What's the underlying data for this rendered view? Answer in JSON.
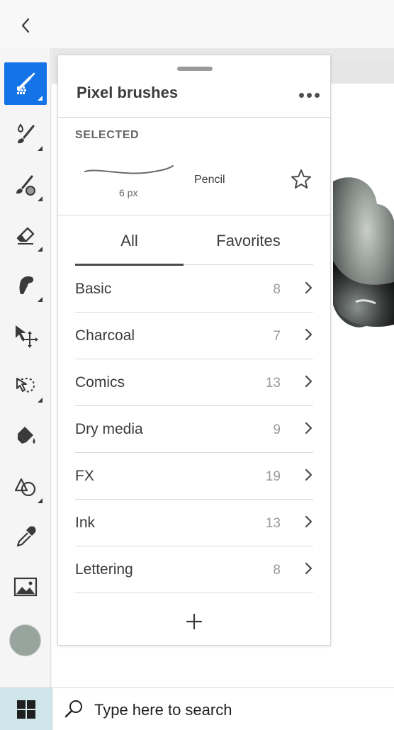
{
  "colors": {
    "accent": "#1473e6",
    "current_color": "#98a59e",
    "taskbar_start": "#cfe6ea"
  },
  "top_bar": {
    "back_icon": "chevron-left-icon"
  },
  "toolbar": {
    "tools": [
      {
        "name": "pixel-brush-tool",
        "icon": "pixel-brush-icon",
        "active": true
      },
      {
        "name": "live-brush-tool",
        "icon": "live-brush-icon"
      },
      {
        "name": "mixer-brush-tool",
        "icon": "mixer-brush-icon"
      },
      {
        "name": "eraser-tool",
        "icon": "eraser-icon"
      },
      {
        "name": "smudge-tool",
        "icon": "smudge-icon"
      },
      {
        "name": "transform-tool",
        "icon": "move-arrow-icon"
      },
      {
        "name": "lasso-tool",
        "icon": "lasso-icon"
      },
      {
        "name": "fill-tool",
        "icon": "paint-bucket-icon"
      },
      {
        "name": "shapes-tool",
        "icon": "shapes-icon"
      },
      {
        "name": "eyedropper-tool",
        "icon": "eyedropper-icon"
      },
      {
        "name": "place-image-tool",
        "icon": "image-icon"
      }
    ]
  },
  "panel": {
    "title": "Pixel brushes",
    "more_icon": "more-horizontal-icon",
    "selected": {
      "label": "SELECTED",
      "size": "6 px",
      "name": "Pencil",
      "favorite_icon": "star-outline-icon"
    },
    "tabs": [
      {
        "label": "All",
        "active": true
      },
      {
        "label": "Favorites",
        "active": false
      }
    ],
    "categories": [
      {
        "name": "Basic",
        "count": "8"
      },
      {
        "name": "Charcoal",
        "count": "7"
      },
      {
        "name": "Comics",
        "count": "13"
      },
      {
        "name": "Dry media",
        "count": "9"
      },
      {
        "name": "FX",
        "count": "19"
      },
      {
        "name": "Ink",
        "count": "13"
      },
      {
        "name": "Lettering",
        "count": "8"
      }
    ],
    "add_icon": "plus-icon"
  },
  "taskbar": {
    "start_icon": "windows-logo-icon",
    "search_icon": "search-icon",
    "search_placeholder": "Type here to search"
  }
}
